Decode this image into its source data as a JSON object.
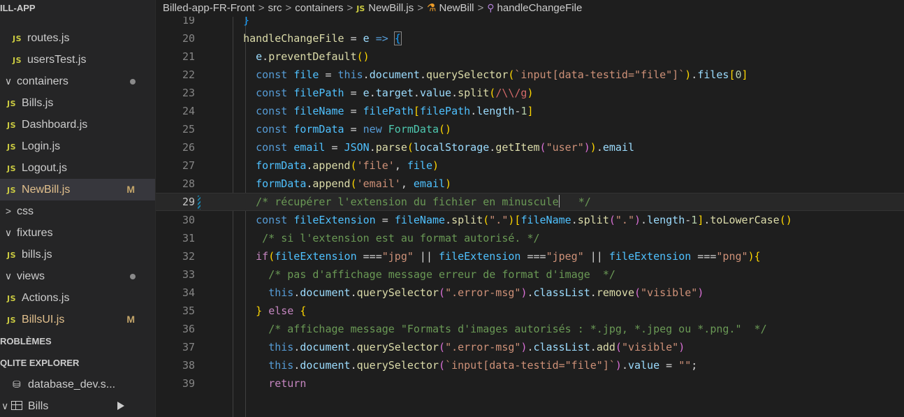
{
  "sidebar": {
    "header": "ILL-APP",
    "items": [
      {
        "type": "file",
        "label": "routes.js",
        "indent": 18
      },
      {
        "type": "file",
        "label": "usersTest.js",
        "indent": 18
      },
      {
        "type": "folder",
        "label": "containers",
        "open": true,
        "dot": true
      },
      {
        "type": "file",
        "label": "Bills.js",
        "indent": 10
      },
      {
        "type": "file",
        "label": "Dashboard.js",
        "indent": 10
      },
      {
        "type": "file",
        "label": "Login.js",
        "indent": 10
      },
      {
        "type": "file",
        "label": "Logout.js",
        "indent": 10
      },
      {
        "type": "file",
        "label": "NewBill.js",
        "indent": 10,
        "active": true,
        "status": "M"
      },
      {
        "type": "folder",
        "label": "css",
        "open": false
      },
      {
        "type": "folder",
        "label": "fixtures",
        "open": true
      },
      {
        "type": "file",
        "label": "bills.js",
        "indent": 10
      },
      {
        "type": "folder",
        "label": "views",
        "open": true,
        "dot": true
      },
      {
        "type": "file",
        "label": "Actions.js",
        "indent": 10
      },
      {
        "type": "file",
        "label": "BillsUI.js",
        "indent": 10,
        "status": "M"
      }
    ],
    "problems_section": "ROBLÈMES",
    "sqlite_section": "QLITE EXPLORER",
    "database": "database_dev.s...",
    "table": "Bills"
  },
  "breadcrumb": {
    "project": "Billed-app-FR-Front",
    "folder1": "src",
    "folder2": "containers",
    "file_badge": "JS",
    "file": "NewBill.js",
    "class": "NewBill",
    "method": "handleChangeFile"
  },
  "editor": {
    "current_line": 29,
    "lines": [
      {
        "n": 19,
        "tokens": [
          {
            "t": "  "
          },
          {
            "t": "}",
            "c": "b3"
          }
        ]
      },
      {
        "n": 20,
        "tokens": [
          {
            "t": "  "
          },
          {
            "t": "handleChangeFile",
            "c": "fn"
          },
          {
            "t": " = "
          },
          {
            "t": "e",
            "c": "var"
          },
          {
            "t": " "
          },
          {
            "t": "=>",
            "c": "kw"
          },
          {
            "t": " "
          },
          {
            "t": "{",
            "c": "b3 bm"
          }
        ]
      },
      {
        "n": 21,
        "tokens": [
          {
            "t": "    "
          },
          {
            "t": "e",
            "c": "var"
          },
          {
            "t": "."
          },
          {
            "t": "preventDefault",
            "c": "fn"
          },
          {
            "t": "()",
            "c": "b1"
          }
        ]
      },
      {
        "n": 22,
        "tokens": [
          {
            "t": "    "
          },
          {
            "t": "const",
            "c": "kw"
          },
          {
            "t": " "
          },
          {
            "t": "file",
            "c": "cst"
          },
          {
            "t": " = "
          },
          {
            "t": "this",
            "c": "kw"
          },
          {
            "t": "."
          },
          {
            "t": "document",
            "c": "var"
          },
          {
            "t": "."
          },
          {
            "t": "querySelector",
            "c": "fn"
          },
          {
            "t": "(",
            "c": "b1"
          },
          {
            "t": "`input[data-testid=\"file\"]`",
            "c": "str"
          },
          {
            "t": ")",
            "c": "b1"
          },
          {
            "t": "."
          },
          {
            "t": "files",
            "c": "var"
          },
          {
            "t": "[",
            "c": "b1"
          },
          {
            "t": "0",
            "c": "num"
          },
          {
            "t": "]",
            "c": "b1"
          }
        ]
      },
      {
        "n": 23,
        "tokens": [
          {
            "t": "    "
          },
          {
            "t": "const",
            "c": "kw"
          },
          {
            "t": " "
          },
          {
            "t": "filePath",
            "c": "cst"
          },
          {
            "t": " = "
          },
          {
            "t": "e",
            "c": "var"
          },
          {
            "t": "."
          },
          {
            "t": "target",
            "c": "var"
          },
          {
            "t": "."
          },
          {
            "t": "value",
            "c": "var"
          },
          {
            "t": "."
          },
          {
            "t": "split",
            "c": "fn"
          },
          {
            "t": "(",
            "c": "b1"
          },
          {
            "t": "/\\\\/g",
            "c": "rx"
          },
          {
            "t": ")",
            "c": "b1"
          }
        ]
      },
      {
        "n": 24,
        "tokens": [
          {
            "t": "    "
          },
          {
            "t": "const",
            "c": "kw"
          },
          {
            "t": " "
          },
          {
            "t": "fileName",
            "c": "cst"
          },
          {
            "t": " = "
          },
          {
            "t": "filePath",
            "c": "cst"
          },
          {
            "t": "[",
            "c": "b1"
          },
          {
            "t": "filePath",
            "c": "cst"
          },
          {
            "t": "."
          },
          {
            "t": "length",
            "c": "var"
          },
          {
            "t": "-"
          },
          {
            "t": "1",
            "c": "num"
          },
          {
            "t": "]",
            "c": "b1"
          }
        ]
      },
      {
        "n": 25,
        "tokens": [
          {
            "t": "    "
          },
          {
            "t": "const",
            "c": "kw"
          },
          {
            "t": " "
          },
          {
            "t": "formData",
            "c": "cst"
          },
          {
            "t": " = "
          },
          {
            "t": "new",
            "c": "kw"
          },
          {
            "t": " "
          },
          {
            "t": "FormData",
            "c": "cls"
          },
          {
            "t": "()",
            "c": "b1"
          }
        ]
      },
      {
        "n": 26,
        "tokens": [
          {
            "t": "    "
          },
          {
            "t": "const",
            "c": "kw"
          },
          {
            "t": " "
          },
          {
            "t": "email",
            "c": "cst"
          },
          {
            "t": " = "
          },
          {
            "t": "JSON",
            "c": "cst"
          },
          {
            "t": "."
          },
          {
            "t": "parse",
            "c": "fn"
          },
          {
            "t": "(",
            "c": "b1"
          },
          {
            "t": "localStorage",
            "c": "var"
          },
          {
            "t": "."
          },
          {
            "t": "getItem",
            "c": "fn"
          },
          {
            "t": "(",
            "c": "b2"
          },
          {
            "t": "\"user\"",
            "c": "str"
          },
          {
            "t": ")",
            "c": "b2"
          },
          {
            "t": ")",
            "c": "b1"
          },
          {
            "t": "."
          },
          {
            "t": "email",
            "c": "var"
          }
        ]
      },
      {
        "n": 27,
        "tokens": [
          {
            "t": "    "
          },
          {
            "t": "formData",
            "c": "cst"
          },
          {
            "t": "."
          },
          {
            "t": "append",
            "c": "fn"
          },
          {
            "t": "(",
            "c": "b1"
          },
          {
            "t": "'file'",
            "c": "str"
          },
          {
            "t": ", "
          },
          {
            "t": "file",
            "c": "cst"
          },
          {
            "t": ")",
            "c": "b1"
          }
        ]
      },
      {
        "n": 28,
        "tokens": [
          {
            "t": "    "
          },
          {
            "t": "formData",
            "c": "cst"
          },
          {
            "t": "."
          },
          {
            "t": "append",
            "c": "fn"
          },
          {
            "t": "(",
            "c": "b1"
          },
          {
            "t": "'email'",
            "c": "str"
          },
          {
            "t": ", "
          },
          {
            "t": "email",
            "c": "cst"
          },
          {
            "t": ")",
            "c": "b1"
          }
        ]
      },
      {
        "n": 29,
        "tokens": [
          {
            "t": "    "
          },
          {
            "t": "/* récupérer l'extension du fichier en minuscule",
            "c": "cmt"
          },
          {
            "cursor": true
          },
          {
            "t": "   */",
            "c": "cmt"
          }
        ]
      },
      {
        "n": 30,
        "tokens": [
          {
            "t": "    "
          },
          {
            "t": "const",
            "c": "kw"
          },
          {
            "t": " "
          },
          {
            "t": "fileExtension",
            "c": "cst"
          },
          {
            "t": " = "
          },
          {
            "t": "fileName",
            "c": "cst"
          },
          {
            "t": "."
          },
          {
            "t": "split",
            "c": "fn"
          },
          {
            "t": "(",
            "c": "b1"
          },
          {
            "t": "\".\"",
            "c": "str"
          },
          {
            "t": ")",
            "c": "b1"
          },
          {
            "t": "[",
            "c": "b1"
          },
          {
            "t": "fileName",
            "c": "cst"
          },
          {
            "t": "."
          },
          {
            "t": "split",
            "c": "fn"
          },
          {
            "t": "(",
            "c": "b2"
          },
          {
            "t": "\".\"",
            "c": "str"
          },
          {
            "t": ")",
            "c": "b2"
          },
          {
            "t": "."
          },
          {
            "t": "length",
            "c": "var"
          },
          {
            "t": "-"
          },
          {
            "t": "1",
            "c": "num"
          },
          {
            "t": "]",
            "c": "b1"
          },
          {
            "t": "."
          },
          {
            "t": "toLowerCase",
            "c": "fn"
          },
          {
            "t": "()",
            "c": "b1"
          }
        ]
      },
      {
        "n": 31,
        "tokens": [
          {
            "t": "     "
          },
          {
            "t": "/* si l'extension est au format autorisé. */",
            "c": "cmt"
          }
        ]
      },
      {
        "n": 32,
        "tokens": [
          {
            "t": "    "
          },
          {
            "t": "if",
            "c": "ctl"
          },
          {
            "t": "(",
            "c": "b1"
          },
          {
            "t": "fileExtension",
            "c": "cst"
          },
          {
            "t": " ==="
          },
          {
            "t": "\"jpg\"",
            "c": "str"
          },
          {
            "t": " || "
          },
          {
            "t": "fileExtension",
            "c": "cst"
          },
          {
            "t": " ==="
          },
          {
            "t": "\"jpeg\"",
            "c": "str"
          },
          {
            "t": " || "
          },
          {
            "t": "fileExtension",
            "c": "cst"
          },
          {
            "t": " ==="
          },
          {
            "t": "\"png\"",
            "c": "str"
          },
          {
            "t": ")",
            "c": "b1"
          },
          {
            "t": "{",
            "c": "b1"
          }
        ]
      },
      {
        "n": 33,
        "tokens": [
          {
            "t": "      "
          },
          {
            "t": "/* pas d'affichage message erreur de format d'image  */",
            "c": "cmt"
          }
        ]
      },
      {
        "n": 34,
        "tokens": [
          {
            "t": "      "
          },
          {
            "t": "this",
            "c": "kw"
          },
          {
            "t": "."
          },
          {
            "t": "document",
            "c": "var"
          },
          {
            "t": "."
          },
          {
            "t": "querySelector",
            "c": "fn"
          },
          {
            "t": "(",
            "c": "b2"
          },
          {
            "t": "\".error-msg\"",
            "c": "str"
          },
          {
            "t": ")",
            "c": "b2"
          },
          {
            "t": "."
          },
          {
            "t": "classList",
            "c": "var"
          },
          {
            "t": "."
          },
          {
            "t": "remove",
            "c": "fn"
          },
          {
            "t": "(",
            "c": "b2"
          },
          {
            "t": "\"visible\"",
            "c": "str"
          },
          {
            "t": ")",
            "c": "b2"
          }
        ]
      },
      {
        "n": 35,
        "tokens": [
          {
            "t": "    "
          },
          {
            "t": "}",
            "c": "b1"
          },
          {
            "t": " "
          },
          {
            "t": "else",
            "c": "ctl"
          },
          {
            "t": " "
          },
          {
            "t": "{",
            "c": "b1"
          }
        ]
      },
      {
        "n": 36,
        "tokens": [
          {
            "t": "      "
          },
          {
            "t": "/* affichage message \"Formats d'images autorisés : *.jpg, *.jpeg ou *.png.\"  */",
            "c": "cmt"
          }
        ]
      },
      {
        "n": 37,
        "tokens": [
          {
            "t": "      "
          },
          {
            "t": "this",
            "c": "kw"
          },
          {
            "t": "."
          },
          {
            "t": "document",
            "c": "var"
          },
          {
            "t": "."
          },
          {
            "t": "querySelector",
            "c": "fn"
          },
          {
            "t": "(",
            "c": "b2"
          },
          {
            "t": "\".error-msg\"",
            "c": "str"
          },
          {
            "t": ")",
            "c": "b2"
          },
          {
            "t": "."
          },
          {
            "t": "classList",
            "c": "var"
          },
          {
            "t": "."
          },
          {
            "t": "add",
            "c": "fn"
          },
          {
            "t": "(",
            "c": "b2"
          },
          {
            "t": "\"visible\"",
            "c": "str"
          },
          {
            "t": ")",
            "c": "b2"
          }
        ]
      },
      {
        "n": 38,
        "tokens": [
          {
            "t": "      "
          },
          {
            "t": "this",
            "c": "kw"
          },
          {
            "t": "."
          },
          {
            "t": "document",
            "c": "var"
          },
          {
            "t": "."
          },
          {
            "t": "querySelector",
            "c": "fn"
          },
          {
            "t": "(",
            "c": "b2"
          },
          {
            "t": "`input[data-testid=\"file\"]`",
            "c": "str"
          },
          {
            "t": ")",
            "c": "b2"
          },
          {
            "t": "."
          },
          {
            "t": "value",
            "c": "var"
          },
          {
            "t": " = "
          },
          {
            "t": "\"\"",
            "c": "str"
          },
          {
            "t": ";"
          }
        ]
      },
      {
        "n": 39,
        "tokens": [
          {
            "t": "      "
          },
          {
            "t": "return",
            "c": "ctl"
          }
        ]
      }
    ]
  },
  "colors": {
    "background": "#1e1e1e",
    "sidebar": "#252526",
    "active_item": "#37373d",
    "js_badge": "#cbcb41"
  }
}
